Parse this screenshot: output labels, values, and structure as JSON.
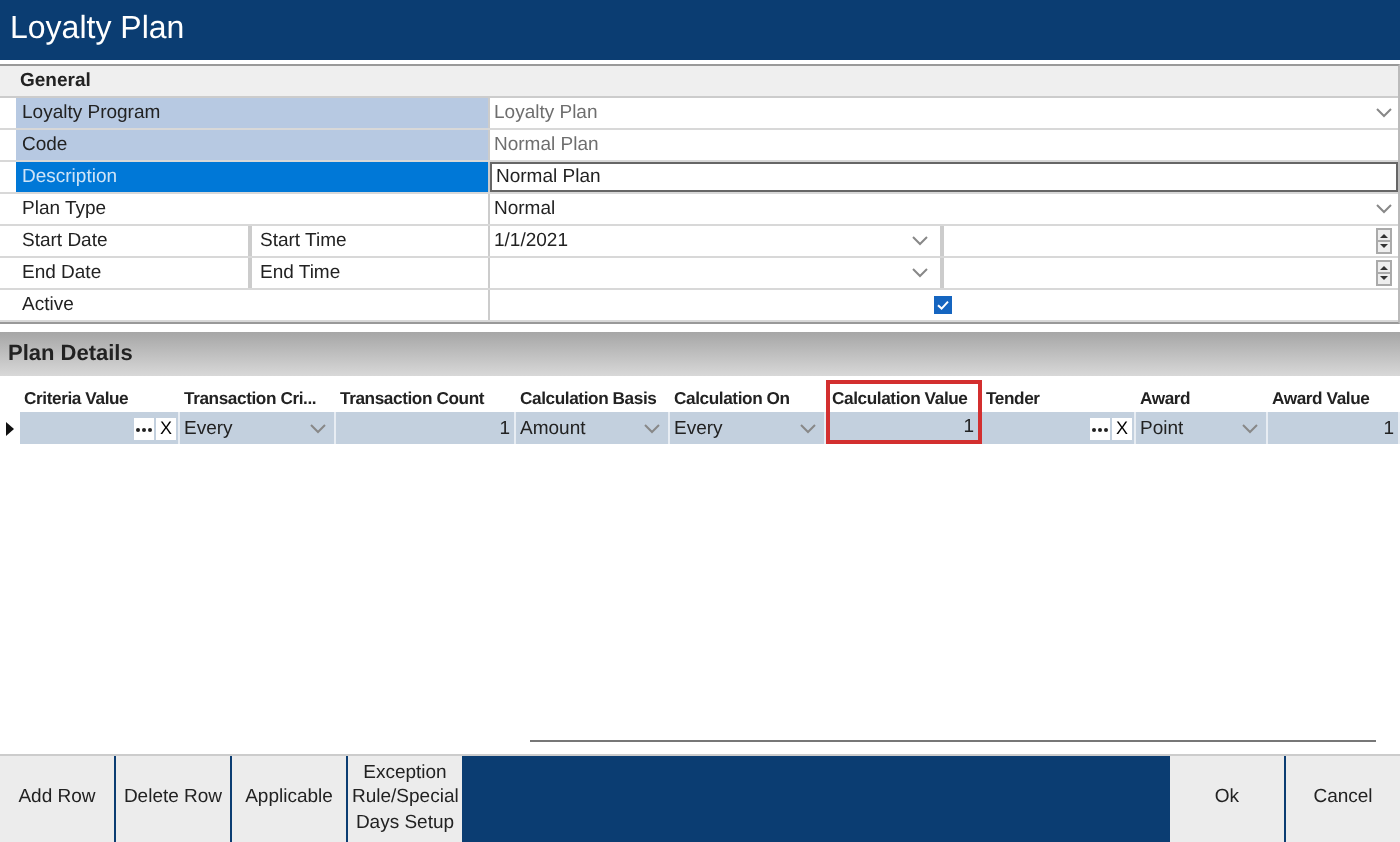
{
  "window": {
    "title": "Loyalty Plan"
  },
  "general": {
    "title": "General",
    "fields": [
      {
        "kind": "dropdown",
        "label": "Loyalty Program",
        "value": "Loyalty Plan",
        "readonly": true,
        "selected": false
      },
      {
        "kind": "text",
        "label": "Code",
        "value": "Normal Plan",
        "readonly": true,
        "selected": false
      },
      {
        "kind": "text",
        "label": "Description",
        "value": "Normal Plan",
        "readonly": false,
        "selected": true
      },
      {
        "kind": "dropdown",
        "label": "Plan Type",
        "value": "Normal",
        "readonly": false,
        "selected": false
      },
      {
        "kind": "datetime",
        "label": "Start Date",
        "sublabel": "Start Time",
        "value": "1/1/2021",
        "readonly": false,
        "selected": false
      },
      {
        "kind": "datetime",
        "label": "End Date",
        "sublabel": "End Time",
        "readonly": false,
        "selected": false
      },
      {
        "kind": "checkbox",
        "label": "Active",
        "checked": true,
        "readonly": false,
        "selected": false
      }
    ]
  },
  "plan_details": {
    "title": "Plan Details",
    "columns": [
      {
        "label": "Criteria Value",
        "highlighted": false
      },
      {
        "label": "Transaction Cri...",
        "highlighted": false
      },
      {
        "label": "Transaction Count",
        "highlighted": false
      },
      {
        "label": "Calculation Basis",
        "highlighted": false
      },
      {
        "label": "Calculation On",
        "highlighted": false
      },
      {
        "label": "Calculation Value",
        "highlighted": true
      },
      {
        "label": "Tender",
        "highlighted": false
      },
      {
        "label": "Award",
        "highlighted": false
      },
      {
        "label": "Award Value",
        "highlighted": false
      }
    ],
    "rows": [
      {
        "current": true,
        "cells": [
          {
            "kind": "lookup",
            "clear": "X"
          },
          {
            "kind": "dropdown",
            "value": "Every"
          },
          {
            "kind": "number",
            "value": "1"
          },
          {
            "kind": "dropdown",
            "value": "Amount"
          },
          {
            "kind": "dropdown",
            "value": "Every"
          },
          {
            "kind": "number",
            "value": "1"
          },
          {
            "kind": "lookup",
            "clear": "X"
          },
          {
            "kind": "dropdown",
            "value": "Point"
          },
          {
            "kind": "number",
            "value": "1"
          }
        ]
      }
    ]
  },
  "footer": {
    "left_buttons": [
      "Add Row",
      "Delete Row",
      "Applicable",
      "Exception Rule/Special Days Setup"
    ],
    "right_buttons": [
      "Ok",
      "Cancel"
    ]
  }
}
